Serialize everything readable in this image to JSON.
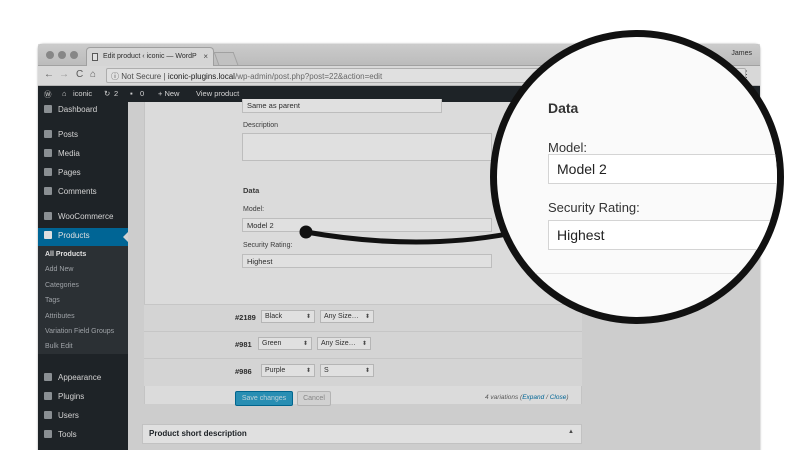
{
  "browser": {
    "tab_title": "Edit product ‹ iconic — WordP",
    "tab_close": "×",
    "user": "James",
    "security": "Not Secure",
    "url_host": "iconic-plugins.local",
    "url_path": "/wp-admin/post.php?post=22&action=edit",
    "back": "←",
    "forward": "→",
    "reload": "C",
    "home": "⌂",
    "menu": "⋮"
  },
  "adminbar": {
    "site": "iconic",
    "updates": "2",
    "comments": "0",
    "new": "+ New",
    "view": "View product"
  },
  "sidebar": {
    "items": [
      {
        "label": "Dashboard"
      },
      {
        "label": "Posts"
      },
      {
        "label": "Media"
      },
      {
        "label": "Pages"
      },
      {
        "label": "Comments"
      },
      {
        "label": "WooCommerce"
      },
      {
        "label": "Products"
      },
      {
        "label": "Appearance"
      },
      {
        "label": "Plugins"
      },
      {
        "label": "Users"
      },
      {
        "label": "Tools"
      }
    ],
    "submenu": [
      "All Products",
      "Add New",
      "Categories",
      "Tags",
      "Attributes",
      "Variation Field Groups",
      "Bulk Edit"
    ]
  },
  "panel": {
    "shipping_value": "Same as parent",
    "description_label": "Description",
    "data_heading": "Data",
    "model_label": "Model:",
    "model_value": "Model 2",
    "security_label": "Security Rating:",
    "security_value": "Highest"
  },
  "variations": [
    {
      "id": "#2189",
      "color": "Black",
      "size": "Any Size…"
    },
    {
      "id": "#981",
      "color": "Green",
      "size": "Any Size…"
    },
    {
      "id": "#986",
      "color": "Purple",
      "size": "S"
    }
  ],
  "actions": {
    "save": "Save changes",
    "cancel": "Cancel",
    "count_text": "4 variations (",
    "expand": "Expand",
    "sep": " / ",
    "close": "Close",
    "count_end": ")"
  },
  "short_description": "Product short description",
  "magnifier": {
    "heading": "Data",
    "model_label": "Model:",
    "model_value": "Model 2",
    "security_label": "Security Rating:",
    "security_value": "Highest"
  },
  "colors": {
    "wp_dark": "#23282d",
    "wp_blue": "#0073aa",
    "save_blue": "#2ea2cc"
  }
}
